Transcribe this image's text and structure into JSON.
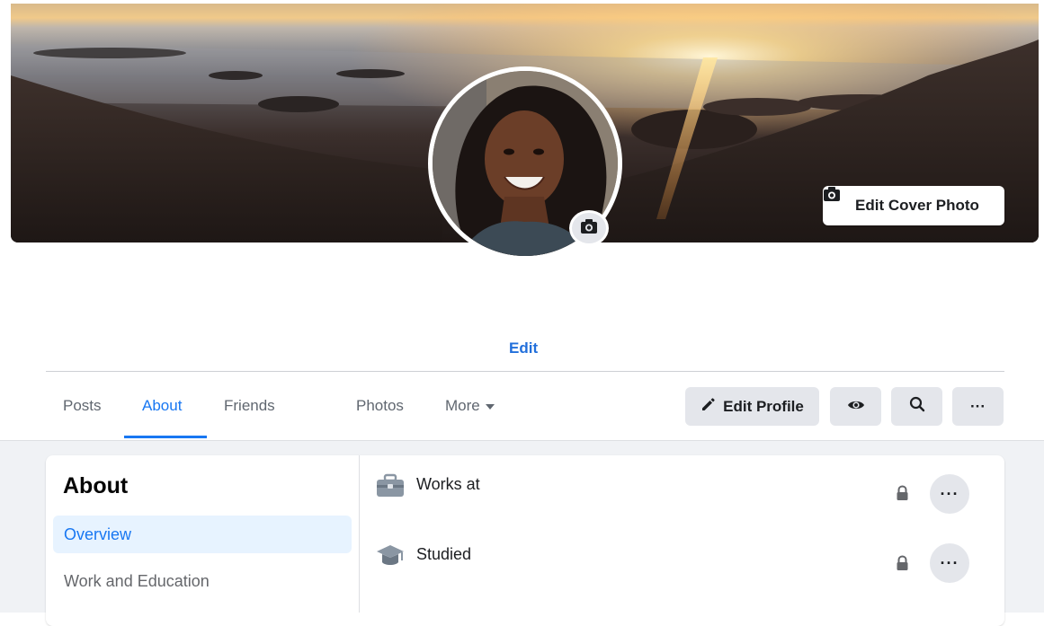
{
  "cover": {
    "edit_cover_label": "Edit Cover Photo",
    "camera_icon": "camera-icon"
  },
  "profile": {
    "avatar_camera_icon": "camera-icon",
    "edit_link": "Edit"
  },
  "tabs": [
    {
      "label": "Posts",
      "active": false
    },
    {
      "label": "About",
      "active": true
    },
    {
      "label": "Friends",
      "active": false
    },
    {
      "label": "Photos",
      "active": false
    },
    {
      "label": "More",
      "active": false
    }
  ],
  "actions": {
    "edit_profile_label": "Edit Profile",
    "view_as_icon": "eye-icon",
    "search_icon": "search-icon",
    "more_icon": "more-horizontal-icon",
    "more_label": "···"
  },
  "about": {
    "title": "About",
    "nav": [
      {
        "label": "Overview",
        "active": true
      },
      {
        "label": "Work and Education",
        "active": false
      }
    ],
    "rows": [
      {
        "label": "Works at",
        "icon": "briefcase-icon",
        "privacy_icon": "lock-icon",
        "more_label": "···"
      },
      {
        "label": "Studied",
        "icon": "graduation-cap-icon",
        "privacy_icon": "lock-icon",
        "more_label": "···"
      }
    ]
  },
  "colors": {
    "accent": "#1877f2",
    "button_gray": "#e4e6eb",
    "page_bg": "#f0f2f5"
  }
}
